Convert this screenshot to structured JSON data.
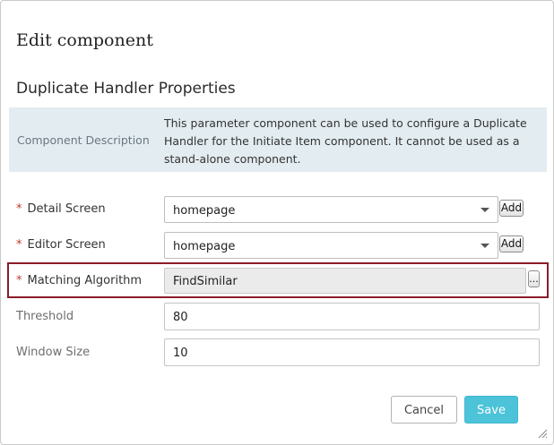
{
  "dialog": {
    "title": "Edit component"
  },
  "section": {
    "title": "Duplicate Handler Properties"
  },
  "description": {
    "label": "Component Description",
    "text": "This parameter component can be used to configure a Duplicate Handler for the Initiate Item component. It cannot be used as a stand-alone component."
  },
  "fields": {
    "required_marker": "*",
    "detail_screen": {
      "label": "Detail Screen",
      "value": "homepage",
      "add_label": "Add"
    },
    "editor_screen": {
      "label": "Editor Screen",
      "value": "homepage",
      "add_label": "Add"
    },
    "matching_algorithm": {
      "label": "Matching Algorithm",
      "value": "FindSimilar",
      "browse_label": "..."
    },
    "threshold": {
      "label": "Threshold",
      "value": "80"
    },
    "window_size": {
      "label": "Window Size",
      "value": "10"
    }
  },
  "footer": {
    "cancel_label": "Cancel",
    "save_label": "Save"
  },
  "colors": {
    "save_button": "#4cc3d9",
    "highlight_border": "#8b1c2a",
    "required": "#c0392b",
    "description_bg": "#e3ecf0"
  }
}
